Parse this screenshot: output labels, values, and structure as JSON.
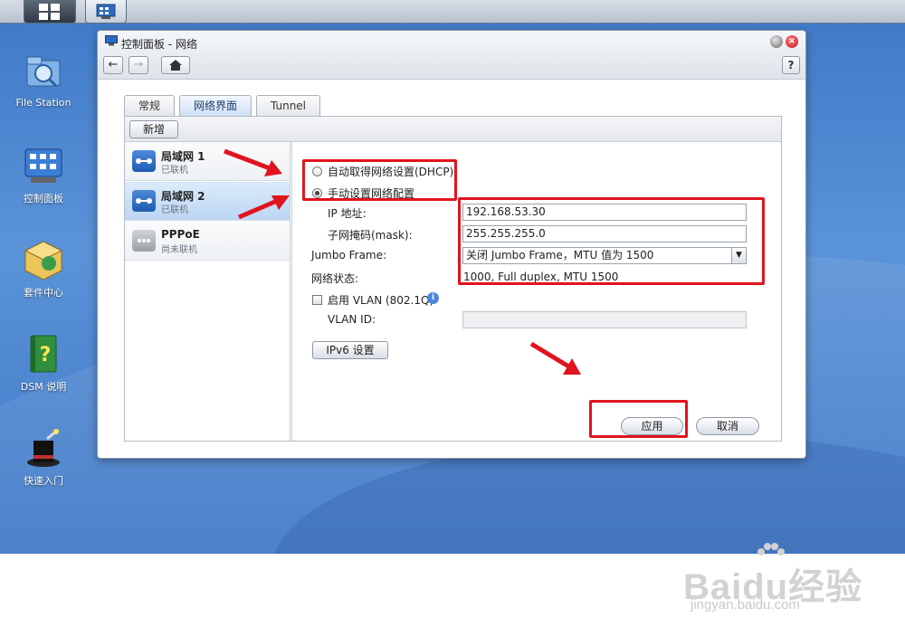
{
  "window": {
    "title": "控制面板 - 网络",
    "help": "?"
  },
  "tabs": [
    "常规",
    "网络界面",
    "Tunnel"
  ],
  "toolbar": {
    "add_label": "新增"
  },
  "interfaces": [
    {
      "name": "局域网 1",
      "status": "已联机"
    },
    {
      "name": "局域网 2",
      "status": "已联机"
    },
    {
      "name": "PPPoE",
      "status": "尚未联机"
    }
  ],
  "form": {
    "dhcp_label": "自动取得网络设置(DHCP)",
    "manual_label": "手动设置网络配置",
    "ip_label": "IP 地址:",
    "ip_value": "192.168.53.30",
    "mask_label": "子网掩码(mask):",
    "mask_value": "255.255.255.0",
    "jumbo_label": "Jumbo Frame:",
    "jumbo_value": "关闭 Jumbo Frame，MTU 值为 1500",
    "status_label": "网络状态:",
    "status_value": "1000, Full duplex, MTU 1500",
    "vlan_label": "启用 VLAN (802.1Q)",
    "vlan_id_label": "VLAN ID:",
    "ipv6_button": "IPv6 设置",
    "apply_button": "应用",
    "cancel_button": "取消"
  },
  "desktop_icons": [
    "File Station",
    "控制面板",
    "套件中心",
    "DSM 说明",
    "快速入门"
  ],
  "watermark": {
    "brand": "Baidu经验",
    "url": "jingyan.baidu.com"
  },
  "colors": {
    "highlight_red": "#e0141e",
    "selected_row": "#bcd6f3",
    "desktop_blue": "#4a84cf"
  }
}
